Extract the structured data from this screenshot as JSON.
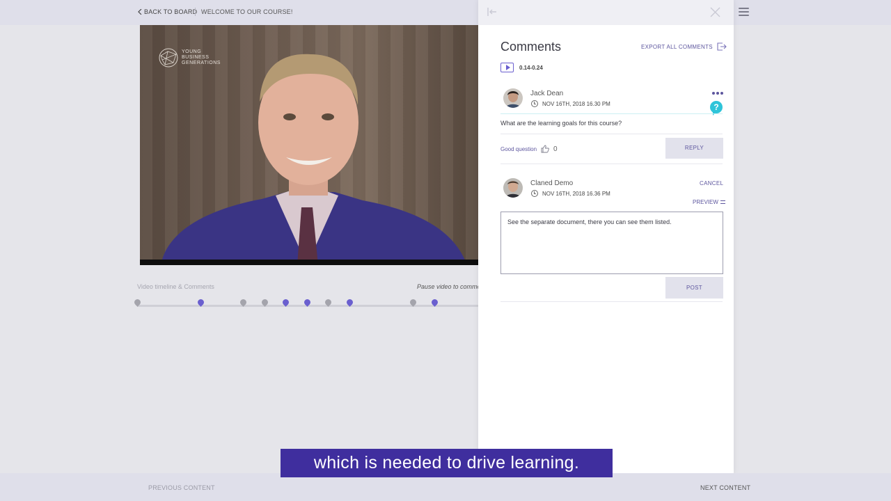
{
  "topbar": {
    "back_label": "BACK TO BOARD",
    "title": "WELCOME TO OUR COURSE!"
  },
  "video": {
    "logo_line1": "YOUNG",
    "logo_line2": "BUSINESS",
    "logo_line3": "GENERATIONS"
  },
  "timeline": {
    "label": "Video timeline & Comments",
    "hint": "Pause video to comment"
  },
  "comments": {
    "title": "Comments",
    "export_label": "EXPORT ALL COMMENTS",
    "clip_range": "0.14-0.24",
    "thread": {
      "author": "Jack Dean",
      "date": "NOV 16TH, 2018 16.30 PM",
      "question_badge": "?",
      "text": "What are the learning goals for this course?",
      "good_question_label": "Good question",
      "likes": "0",
      "reply_label": "REPLY"
    },
    "draft": {
      "author": "Claned Demo",
      "date": "NOV 16TH, 2018 16.36 PM",
      "cancel_label": "CANCEL",
      "preview_label": "PREVIEW",
      "text": "See the separate document, there you can see them listed.",
      "post_label": "POST"
    }
  },
  "footer": {
    "previous_label": "PREVIOUS CONTENT",
    "next_label": "NEXT CONTENT"
  },
  "caption": "which is needed to drive learning."
}
